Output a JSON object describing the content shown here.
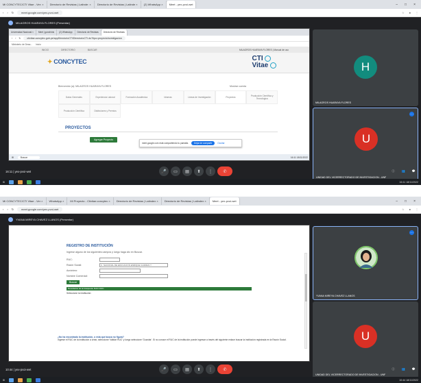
{
  "shot1": {
    "tabs": [
      {
        "label": "Mi CONCYTEC/CTI Vitae - Ver: ×"
      },
      {
        "label": "Directorio de Revistas | Latinde: ×"
      },
      {
        "label": "Directorio de Revistas | Latinde ×"
      },
      {
        "label": "(2) WhatsApp ×"
      },
      {
        "label": "Meet - yex-pvoi-wet"
      }
    ],
    "url": "meet.google.com/yex-pvoi-wet",
    "presenter": "MILAGROS HUARAYA FLORES (Presentar)",
    "inner": {
      "tabs": [
        "Universidad Nacional ×",
        "Meet | gonzhinis",
        "(2) WhatsApp",
        "Directorio de Revistas",
        "Directorio de Revistas"
      ],
      "url": "ctivitae.concytec.gob.pe/appDirectorioCTI/DirectorioCTI.do?tipo=proyectoInvestigacion",
      "bookmarks": [
        "Ministerio de Desa...",
        "Inicio"
      ],
      "nav": [
        "INICIO",
        "DIRECTORIO",
        "BUSCAR"
      ],
      "nav_right": "MILAGROS HUARAYA FLORES | Manual de uso",
      "logo_left": "CONCYTEC",
      "logo_right_top": "CTI",
      "logo_right_bottom": "Vitae",
      "welcome": "Bienvenido (a): MILAGROS HUARAYA FLORES",
      "account": "Mostrar cuenta",
      "sections": [
        "Datos Generales",
        "Experiencia Laboral",
        "Formación Académica",
        "Idiomas",
        "Líneas de Investigación",
        "Proyectos",
        "Producción Científica y Tecnológica",
        "Producción Científica",
        "Distinciones y Premios"
      ],
      "projects_title": "PROYECTOS",
      "add_button": "Agregar Proyecto",
      "share_text": "meet.google.com está compartiendo tu pantalla.",
      "share_stop": "Dejar de compartir",
      "share_hide": "Ocultar",
      "task_search": "Buscar",
      "task_clock": "16:11 18/11/2022"
    },
    "participants": [
      {
        "initial": "H",
        "name": "MILAGROS HUARAYA FLORES",
        "color": "#128c7e"
      },
      {
        "initial": "U",
        "name": "UNIDAD DEL VICERRECTORADO DE INVESTIGACION - UNF",
        "color": "#d93025"
      }
    ],
    "meeting_info": "16:11 | yex-pvoi-wet",
    "os_clock": "16:11 18/11/2022"
  },
  "shot2": {
    "tabs": [
      {
        "label": "Mi CONCYTEC/CTI Vitae - Ver ×"
      },
      {
        "label": "WhatsApp ×"
      },
      {
        "label": "Mi Proyecto - Ctivitae.concytec ×"
      },
      {
        "label": "Directorio de Revistas | Latindex ×"
      },
      {
        "label": "Directorio de Revistas | Latindex ×"
      },
      {
        "label": "Meet - yex-pvoi-wet"
      }
    ],
    "url": "meet.google.com/yex-pvoi-wet",
    "presenter": "YVANA MIREYA CHAVEZ LLANOS (Presentar)",
    "form": {
      "title": "REGISTRO DE INSTITUCIÓN",
      "instructions": "Ingrese alguno de los siguientes campos y luego haga clic en Buscar.",
      "fields": [
        {
          "label": "RUC:",
          "value": ""
        },
        {
          "label": "Razón Social:",
          "value": "U. NACIONAL DE EDUCACION ENRIQUE GUZMAN Y"
        },
        {
          "label": "Acrónimo:",
          "value": ""
        },
        {
          "label": "Nombre Comercial:",
          "value": ""
        }
      ],
      "search_button": "Buscar",
      "results_bar": "Resultados de la búsqueda: RAN CIRC",
      "results_subtitle": "Seleccione la Institución:",
      "note_question": "¿No ha encontrado la institución, o esta que busca no figura?",
      "note_text": "Ingrese el RUC de la institución a crear, seleccione 'Validar RUC' y luego seleccione 'Guardar'. Si no conoce el RUC de la institución puede ingresar a través del siguiente enlace buscar la institución registrada en la Razón Social."
    },
    "participants": [
      {
        "initial": "Y",
        "name": "YVANA MIREYA CHAVEZ LLANOS",
        "color": "#3c4043"
      },
      {
        "initial": "U",
        "name": "UNIDAD DEL VICERRECTORADO DE INVESTIGACION - UNF",
        "color": "#d93025"
      }
    ],
    "meeting_info": "10:44 | yex-pvoi-wet",
    "os_clock": "10:44 18/11/2022"
  },
  "colors": {
    "meet_bg": "#202124",
    "end_call": "#ea4335",
    "concytec_green": "#2d7a3a",
    "concytec_blue": "#2a5a9e",
    "highlight": "#8ab4f8"
  }
}
